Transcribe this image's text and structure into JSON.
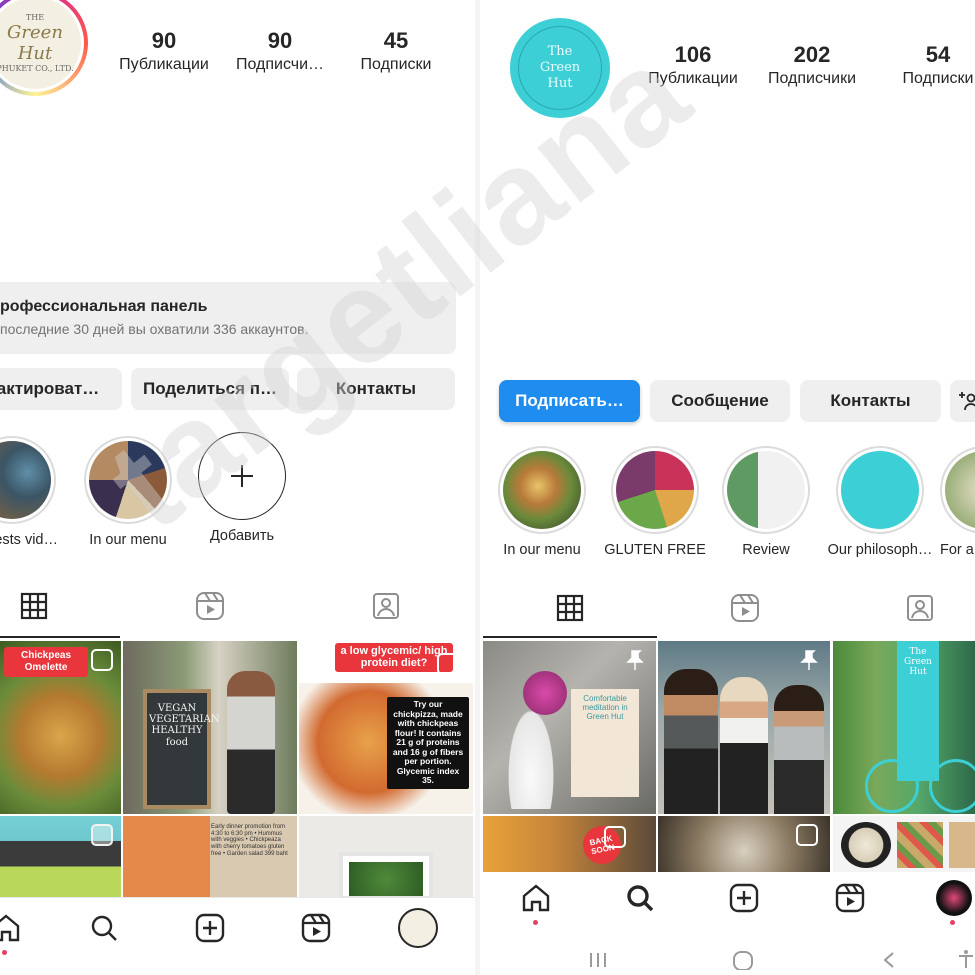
{
  "left": {
    "avatar": {
      "small_top": "THE",
      "main": "Green Hut",
      "small_bottom": "PHUKET CO., LTD."
    },
    "stats": [
      {
        "num": "90",
        "label": "Публикации"
      },
      {
        "num": "90",
        "label": "Подписчи…"
      },
      {
        "num": "45",
        "label": "Подписки"
      }
    ],
    "pro": {
      "title": "рофессиональная панель",
      "subtitle": "последние 30 дней вы охватили 336 аккаунтов."
    },
    "buttons": {
      "edit": "дактироват…",
      "share": "Поделиться п…",
      "contacts": "Контакты"
    },
    "highlights": [
      {
        "label": "ests vid…"
      },
      {
        "label": "In our menu"
      },
      {
        "label": "Добавить"
      }
    ],
    "grid": {
      "cell1_label": "Chickpeas Omelette",
      "cell2_text": "VEGAN VEGETARIAN HEALTHY food",
      "cell3_head": "a low glycemic/ high protein diet?",
      "cell3_body": "Try our chickpizza, made with chickpeas flour! It contains 21 g of proteins and 16 g of fibers per portion. Glycemic index 35.",
      "cell5_text": "Early dinner promotion from 4:30 to 6:30 pm • Hummus with veggies • Chickpeaza with cherry tomatoes gluten free • Garden salad 399 baht"
    }
  },
  "right": {
    "avatar": {
      "line1": "The",
      "line2": "Green",
      "line3": "Hut"
    },
    "stats": [
      {
        "num": "106",
        "label": "Публикации"
      },
      {
        "num": "202",
        "label": "Подписчики"
      },
      {
        "num": "54",
        "label": "Подписки"
      }
    ],
    "buttons": {
      "follow": "Подписать…",
      "message": "Сообщение",
      "contacts": "Контакты"
    },
    "highlights": [
      {
        "label": "In our menu"
      },
      {
        "label": "GLUTEN FREE"
      },
      {
        "label": "Review"
      },
      {
        "label": "Our philosoph…"
      },
      {
        "label": "For a"
      }
    ],
    "grid": {
      "cell1_sign": "Comfortable meditation in Green Hut",
      "cell3_sign": "The Green Hut",
      "cell4_badge": "BACK SOON"
    }
  },
  "watermark": "targetliana",
  "colors": {
    "primary_blue": "#1f8cf0",
    "teal": "#3ccfd6",
    "notification": "#e4405f",
    "button_gray": "#efefef"
  }
}
